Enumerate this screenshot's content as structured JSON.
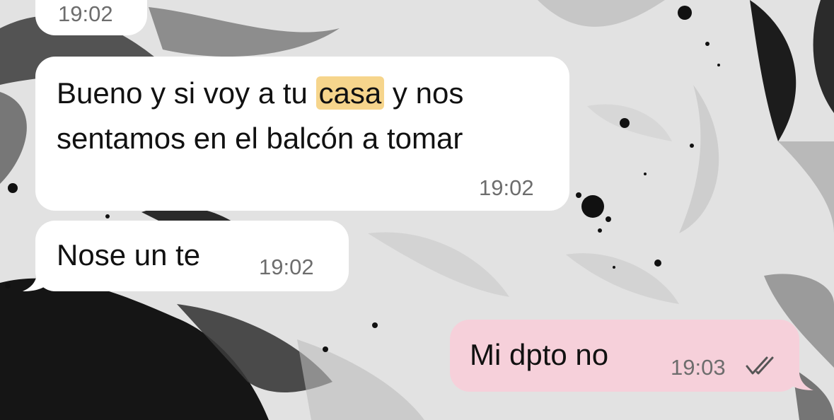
{
  "chat": {
    "messages": [
      {
        "direction": "incoming",
        "time": "19:02"
      },
      {
        "direction": "incoming",
        "text_before": "Bueno y si voy a tu ",
        "highlight": "casa",
        "text_after": " y nos",
        "line2": "sentamos en el balcón a tomar",
        "time": "19:02",
        "highlight_color": "#f6d58c"
      },
      {
        "direction": "incoming",
        "text": "Nose un te",
        "time": "19:02"
      },
      {
        "direction": "outgoing",
        "text": "Mi dpto no",
        "time": "19:03",
        "status_icon": "double-check-icon",
        "bubble_color": "#f6d0da"
      }
    ]
  }
}
